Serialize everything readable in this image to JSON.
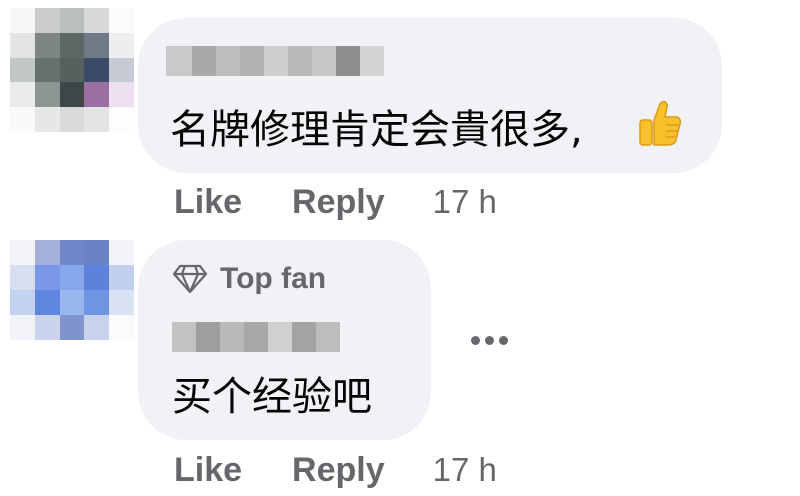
{
  "comments": [
    {
      "text": "名牌修理肯定会貴很多,",
      "emoji": "thumbs-up-icon",
      "like_label": "Like",
      "reply_label": "Reply",
      "time": "17 h"
    },
    {
      "badge": "Top fan",
      "badge_icon": "diamond-icon",
      "text": "买个经验吧",
      "like_label": "Like",
      "reply_label": "Reply",
      "time": "17 h"
    }
  ],
  "colors": {
    "bubble": "#f0f2f5",
    "meta_text": "#65676b",
    "body_text": "#050505"
  }
}
